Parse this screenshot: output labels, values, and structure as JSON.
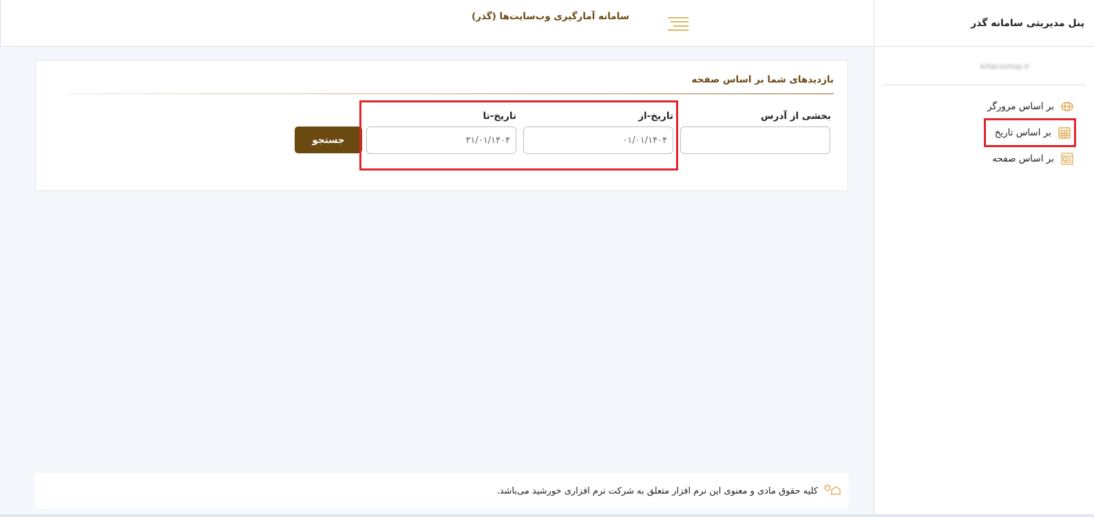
{
  "sidebar": {
    "panel_title": "پنل مدیریتی سامانه گذر",
    "site_domain": "kiliacsshop.ir",
    "items": [
      {
        "label": "بر اساس مرورگر",
        "icon": "globe-icon"
      },
      {
        "label": "بر اساس تاریخ",
        "icon": "calendar-icon",
        "active": true
      },
      {
        "label": "بر اساس صفحه",
        "icon": "page-icon"
      }
    ]
  },
  "header": {
    "app_title": "سامانه آمارگیری وب‌سایت‌ها (گذر)"
  },
  "card": {
    "title": "بازدیدهای شما بر اساس صفحه",
    "address_label": "بخشی از آدرس",
    "address_value": "",
    "date_from_label": "تاریخ-از",
    "date_from_value": "۰۱/۰۱/۱۴۰۴",
    "date_to_label": "تاریخ-تا",
    "date_to_value": "۳۱/۰۱/۱۴۰۴",
    "search_label": "جستجو"
  },
  "footer": {
    "copyright": "کلیه حقوق مادی و معنوی این نرم افزار متعلق به شرکت نرم افزاری خورشید می‌باشد."
  },
  "colors": {
    "brand_brown": "#6b4a12",
    "highlight_red": "#e32329",
    "icon_gold": "#d9a441"
  }
}
